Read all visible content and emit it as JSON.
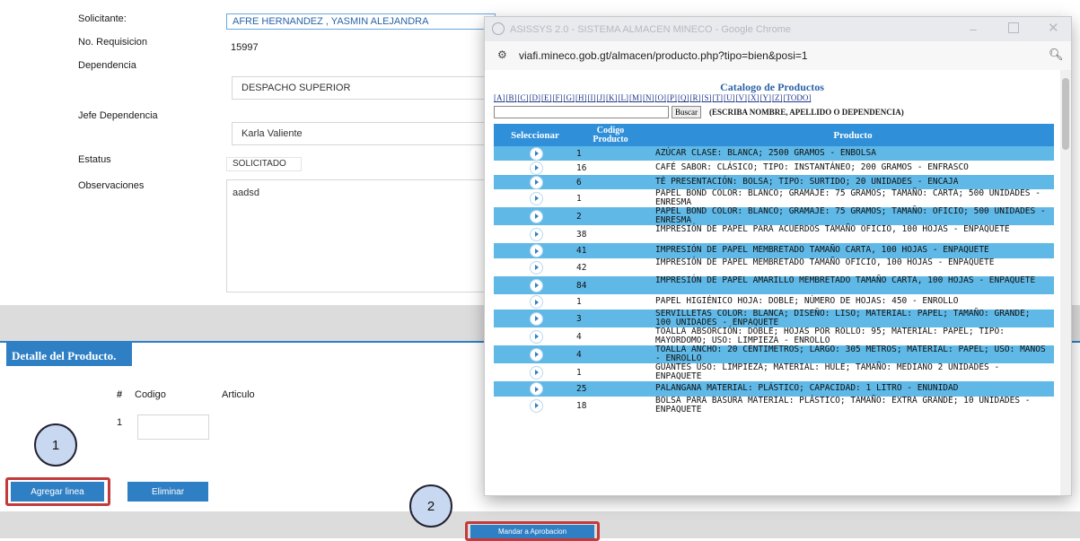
{
  "form": {
    "solicitante_label": "Solicitante:",
    "solicitante_value": "AFRE HERNANDEZ  , YASMIN ALEJANDRA",
    "requisicion_label": "No. Requisicion",
    "requisicion_value": "15997",
    "dependencia_label": "Dependencia",
    "dependencia_value": "DESPACHO SUPERIOR",
    "jefe_label": "Jefe Dependencia",
    "jefe_value": "Karla Valiente",
    "estatus_label": "Estatus",
    "estatus_value": "SOLICITADO",
    "observaciones_label": "Observaciones",
    "observaciones_value": "aadsd"
  },
  "detalle": {
    "tab_label": "Detalle del Producto.",
    "col_num": "#",
    "col_codigo": "Codigo",
    "col_articulo": "Articulo",
    "row_num": "1",
    "agregar_label": "Agregar linea",
    "eliminar_label": "Eliminar",
    "mandar_label": "Mandar a Aprobacion"
  },
  "annotations": {
    "one": "1",
    "two": "2"
  },
  "popup": {
    "window_title": "ASISSYS 2.0 - SISTEMA ALMACEN MINECO - Google Chrome",
    "url": "viafi.mineco.gob.gt/almacen/producto.php?tipo=bien&posi=1",
    "catalog_title": "Catalogo de Productos",
    "letters": [
      "[A]",
      "[B]",
      "[C]",
      "[D]",
      "[E]",
      "[F]",
      "[G]",
      "[H]",
      "[I]",
      "[J]",
      "[K]",
      "[L]",
      "[M]",
      "[N]",
      "[O]",
      "[P]",
      "[Q]",
      "[R]",
      "[S]",
      "[T]",
      "[U]",
      "[V]",
      "[X]",
      "[Y]",
      "[Z]",
      "[TODO]"
    ],
    "search_button": "Buscar",
    "search_hint": "(ESCRIBA NOMBRE, APELLIDO O DEPENDENCIA)",
    "headers": {
      "select": "Seleccionar",
      "code": "Codigo Producto",
      "product": "Producto"
    },
    "rows": [
      {
        "code": "1",
        "product": "AZÚCAR CLASE: BLANCA; 2500 GRAMOS - ENBOLSA"
      },
      {
        "code": "16",
        "product": "CAFÉ SABOR: CLÁSICO; TIPO: INSTANTÁNEO; 200 GRAMOS - ENFRASCO"
      },
      {
        "code": "6",
        "product": "TÉ PRESENTACIÓN: BOLSA; TIPO: SURTIDO; 20 UNIDADES - ENCAJA"
      },
      {
        "code": "1",
        "product": "PAPEL BOND COLOR: BLANCO; GRAMAJE: 75 GRAMOS; TAMAÑO: CARTA; 500 UNIDADES - ENRESMA"
      },
      {
        "code": "2",
        "product": "PAPEL BOND COLOR: BLANCO; GRAMAJE: 75 GRAMOS; TAMAÑO: OFICIO; 500 UNIDADES - ENRESMA"
      },
      {
        "code": "38",
        "product": "IMPRESIÓN DE PAPEL PARA ACUERDOS TAMAÑO OFICIO, 100 HOJAS - ENPAQUETE"
      },
      {
        "code": "41",
        "product": "IMPRESIÓN DE PAPEL MEMBRETADO TAMAÑO CARTA, 100 HOJAS - ENPAQUETE"
      },
      {
        "code": "42",
        "product": "IMPRESIÓN DE PAPEL MEMBRETADO TAMAÑO OFICIO, 100 HOJAS - ENPAQUETE"
      },
      {
        "code": "84",
        "product": "IMPRESIÓN DE PAPEL AMARILLO MEMBRETADO TAMAÑO CARTA, 100 HOJAS - ENPAQUETE"
      },
      {
        "code": "1",
        "product": "PAPEL HIGIÉNICO HOJA: DOBLE; NÚMERO DE HOJAS: 450 - ENROLLO"
      },
      {
        "code": "3",
        "product": "SERVILLETAS COLOR: BLANCA; DISEÑO: LISO; MATERIAL: PAPEL; TAMAÑO: GRANDE; 100 UNIDADES - ENPAQUETE"
      },
      {
        "code": "4",
        "product": "TOALLA ABSORCIÓN: DOBLE; HOJAS POR ROLLO: 95; MATERIAL: PAPEL; TIPO: MAYORDOMO; USO: LIMPIEZA - ENROLLO"
      },
      {
        "code": "4",
        "product": "TOALLA ANCHO: 20 CENTIMETROS; LARGO: 305 METROS; MATERIAL: PAPEL; USO: MANOS - ENROLLO"
      },
      {
        "code": "1",
        "product": "GUANTES USO: LIMPIEZA; MATERIAL: HULE; TAMAÑO: MEDIANO 2 UNIDADES - ENPAQUETE"
      },
      {
        "code": "25",
        "product": "PALANGANA MATERIAL: PLÁSTICO; CAPACIDAD: 1 LITRO - ENUNIDAD"
      },
      {
        "code": "18",
        "product": "BOLSA PARA BASURA MATERIAL: PLÁSTICO; TAMAÑO: EXTRA GRANDE; 10 UNIDADES - ENPAQUETE"
      }
    ]
  }
}
